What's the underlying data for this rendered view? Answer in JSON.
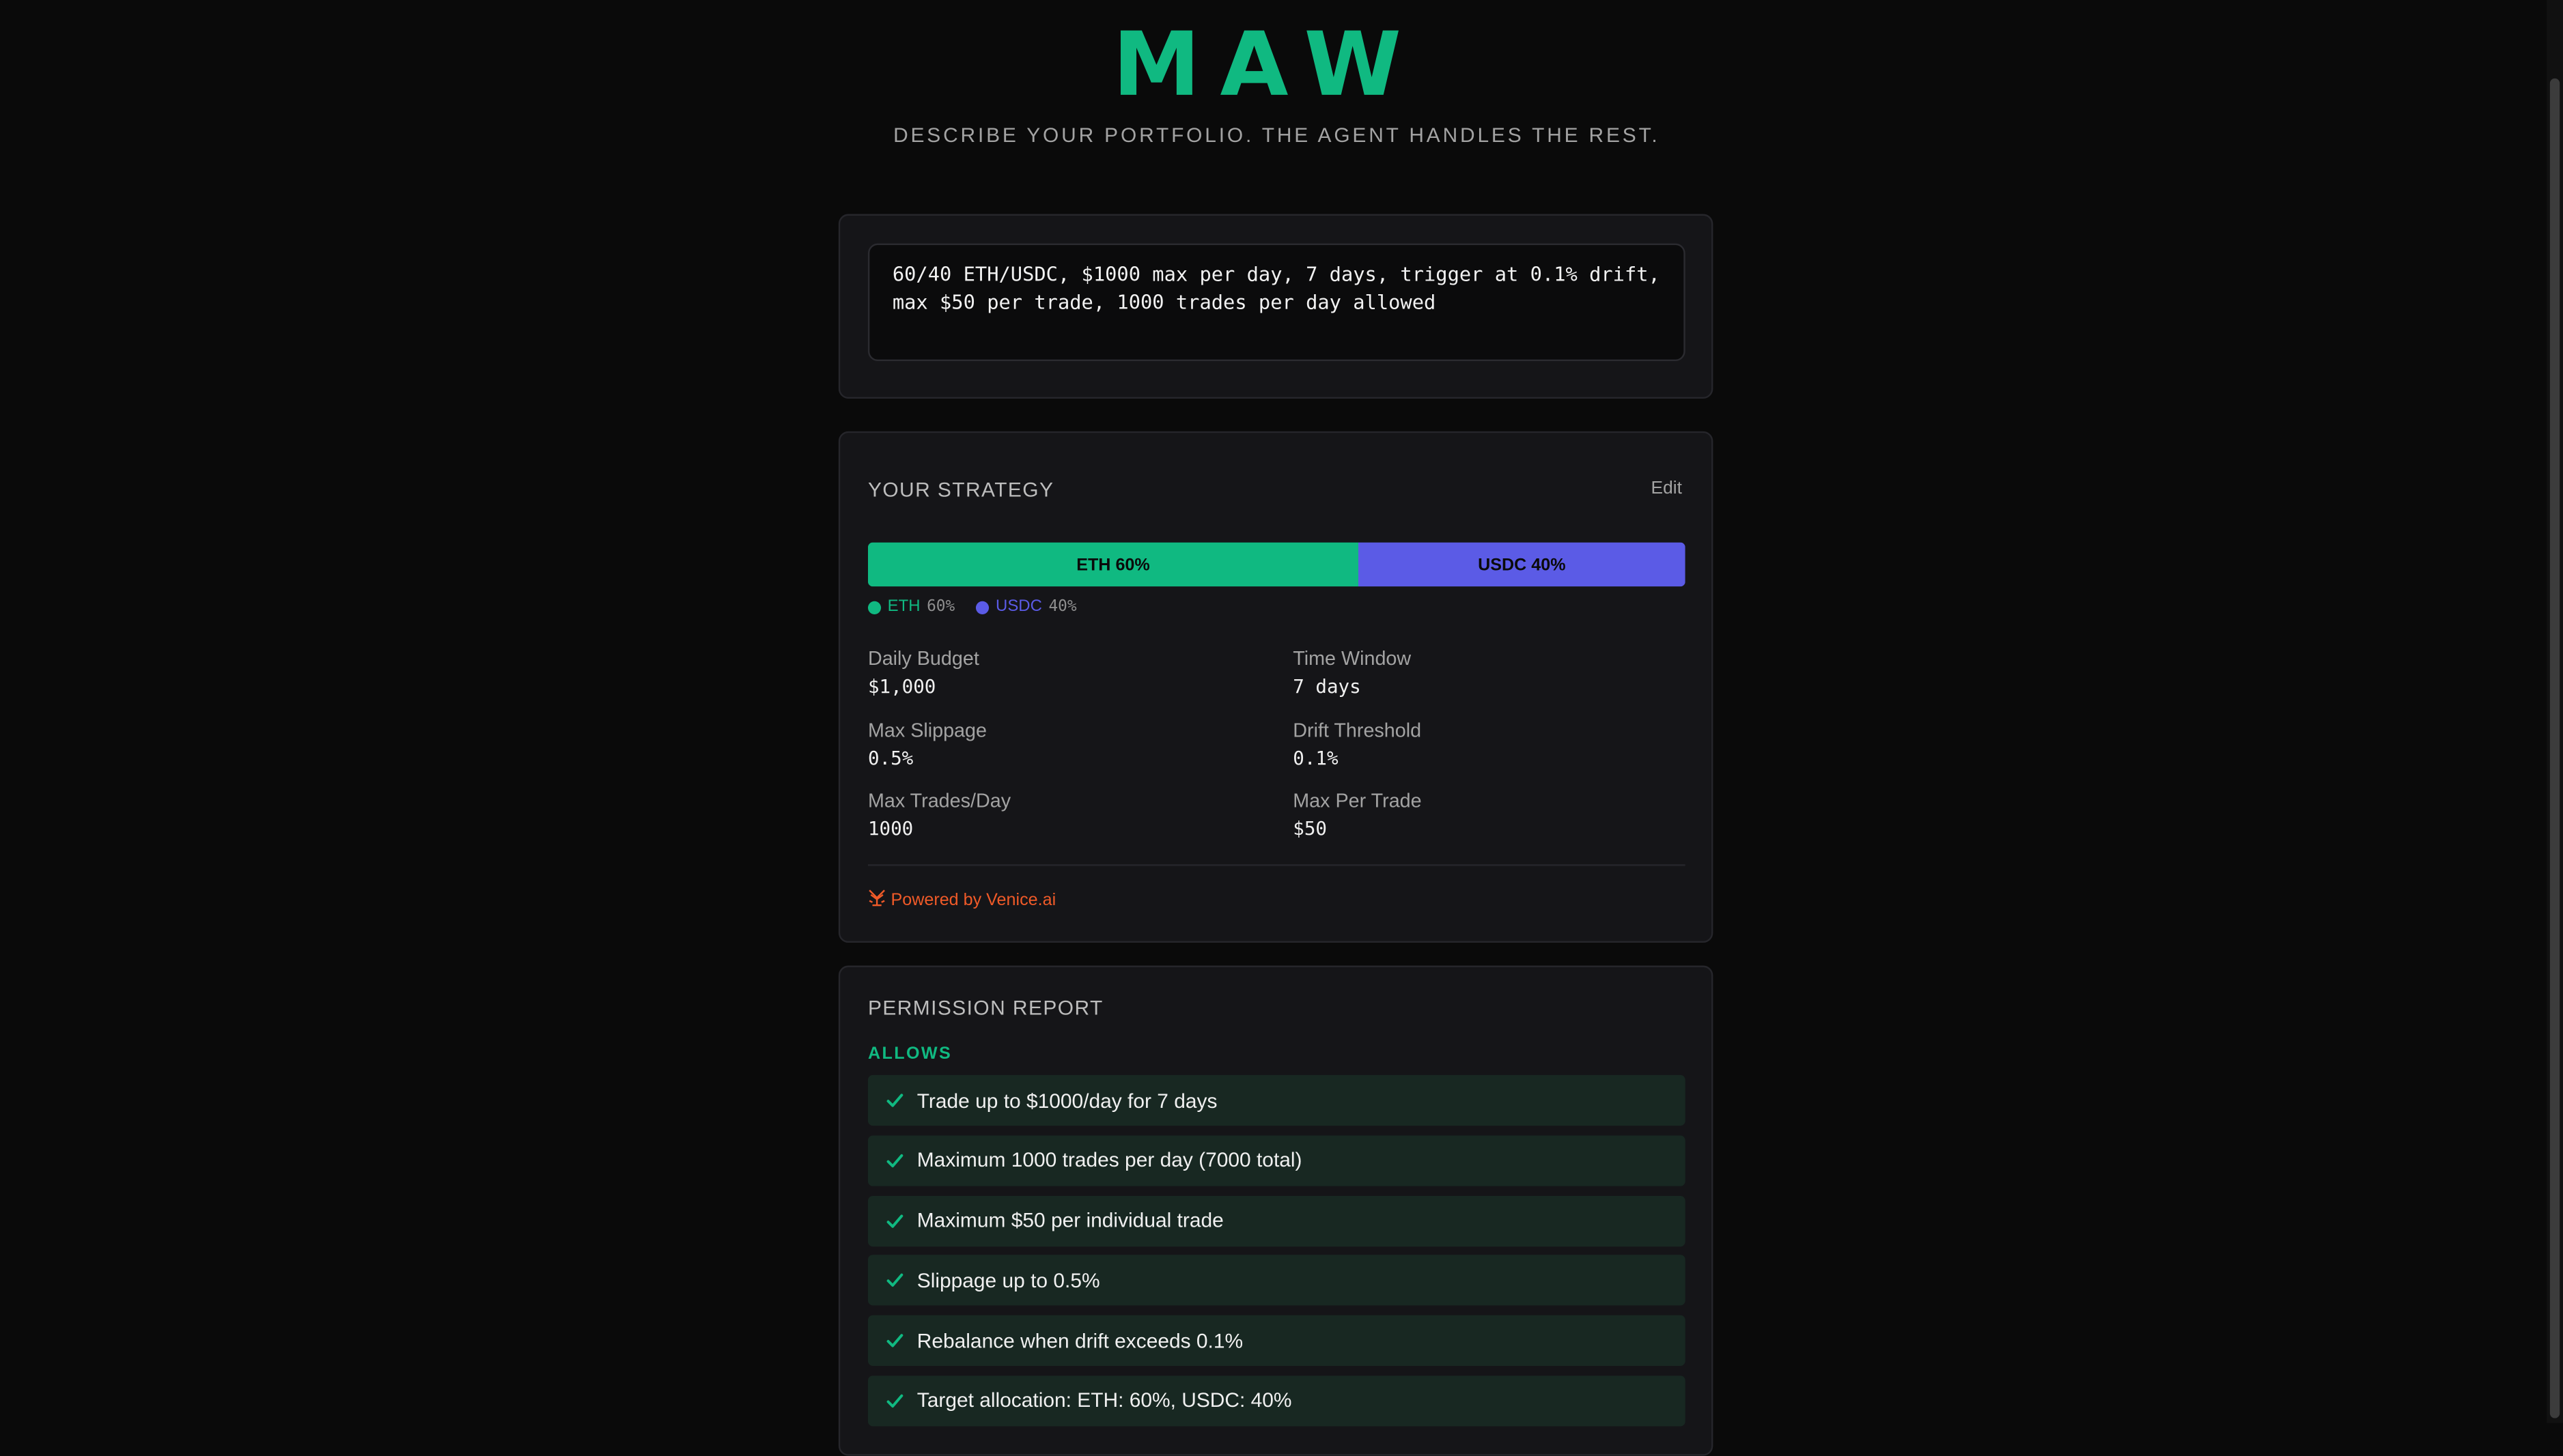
{
  "header": {
    "logo": "MAW",
    "tagline": "DESCRIBE YOUR PORTFOLIO. THE AGENT HANDLES THE REST."
  },
  "prompt": {
    "value": "60/40 ETH/USDC, $1000 max per day, 7 days, trigger at 0.1% drift,\nmax $50 per trade, 1000 trades per day allowed"
  },
  "strategy": {
    "title": "YOUR STRATEGY",
    "edit_label": "Edit",
    "allocation": [
      {
        "asset": "ETH",
        "percent_label": "60%",
        "bar_label": "ETH 60%",
        "fraction": 0.6,
        "color": "#10b981"
      },
      {
        "asset": "USDC",
        "percent_label": "40%",
        "bar_label": "USDC 40%",
        "fraction": 0.4,
        "color": "#5b5be6"
      }
    ],
    "params": {
      "daily_budget": {
        "label": "Daily Budget",
        "value": "$1,000"
      },
      "time_window": {
        "label": "Time Window",
        "value": "7 days"
      },
      "max_slippage": {
        "label": "Max Slippage",
        "value": "0.5%"
      },
      "drift_threshold": {
        "label": "Drift Threshold",
        "value": "0.1%"
      },
      "max_trades_day": {
        "label": "Max Trades/Day",
        "value": "1000"
      },
      "max_per_trade": {
        "label": "Max Per Trade",
        "value": "$50"
      }
    },
    "powered_by": "Powered by Venice.ai",
    "powered_icon": "venice-logo-icon",
    "accent_color": "#f05a28"
  },
  "permission": {
    "title": "PERMISSION REPORT",
    "allows_label": "ALLOWS",
    "allows": [
      "Trade up to $1000/day for 7 days",
      "Maximum 1000 trades per day (7000 total)",
      "Maximum $50 per individual trade",
      "Slippage up to 0.5%",
      "Rebalance when drift exceeds 0.1%",
      "Target allocation: ETH: 60%, USDC: 40%"
    ],
    "check_icon": "check-icon"
  }
}
